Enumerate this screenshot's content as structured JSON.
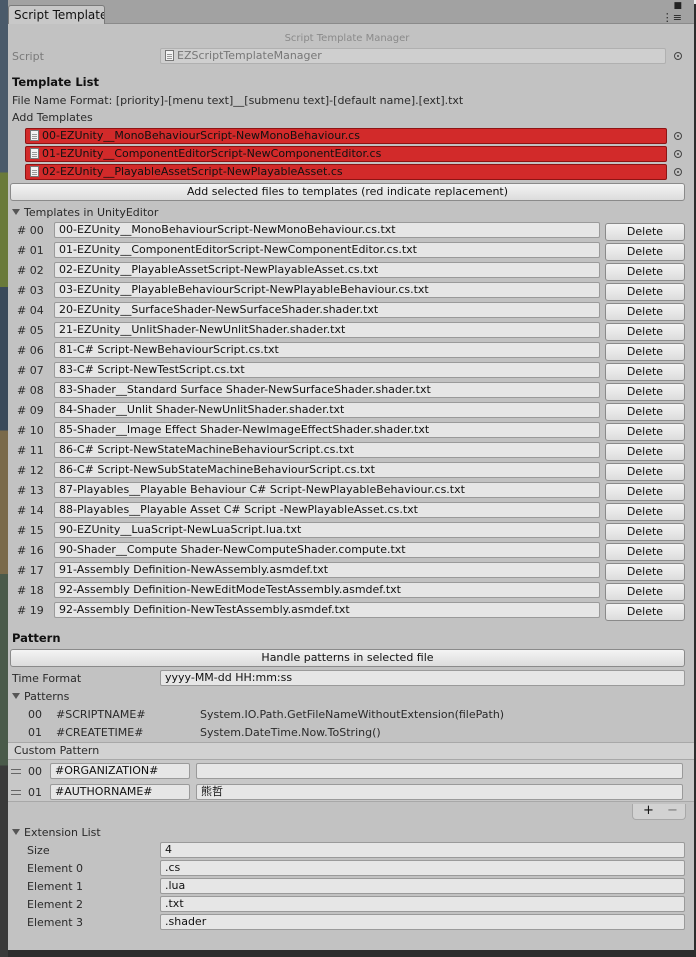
{
  "tab": {
    "title": "Script Template"
  },
  "header": {
    "title": "Script Template Manager"
  },
  "script_field": {
    "label": "Script",
    "value": "EZScriptTemplateManager"
  },
  "template_list": {
    "heading": "Template List",
    "file_name_format": "File Name Format: [priority]-[menu text]__[submenu text]-[default name].[ext].txt",
    "add_templates_label": "Add Templates",
    "add_files": [
      "00-EZUnity__MonoBehaviourScript-NewMonoBehaviour.cs",
      "01-EZUnity__ComponentEditorScript-NewComponentEditor.cs",
      "02-EZUnity__PlayableAssetScript-NewPlayableAsset.cs"
    ],
    "add_button": "Add selected files to templates (red indicate replacement)"
  },
  "templates_in_editor": {
    "foldout": "Templates in UnityEditor",
    "delete_label": "Delete",
    "items": [
      {
        "index": "# 00",
        "name": "00-EZUnity__MonoBehaviourScript-NewMonoBehaviour.cs.txt"
      },
      {
        "index": "# 01",
        "name": "01-EZUnity__ComponentEditorScript-NewComponentEditor.cs.txt"
      },
      {
        "index": "# 02",
        "name": "02-EZUnity__PlayableAssetScript-NewPlayableAsset.cs.txt"
      },
      {
        "index": "# 03",
        "name": "03-EZUnity__PlayableBehaviourScript-NewPlayableBehaviour.cs.txt"
      },
      {
        "index": "# 04",
        "name": "20-EZUnity__SurfaceShader-NewSurfaceShader.shader.txt"
      },
      {
        "index": "# 05",
        "name": "21-EZUnity__UnlitShader-NewUnlitShader.shader.txt"
      },
      {
        "index": "# 06",
        "name": "81-C# Script-NewBehaviourScript.cs.txt"
      },
      {
        "index": "# 07",
        "name": "83-C# Script-NewTestScript.cs.txt"
      },
      {
        "index": "# 08",
        "name": "83-Shader__Standard Surface Shader-NewSurfaceShader.shader.txt"
      },
      {
        "index": "# 09",
        "name": "84-Shader__Unlit Shader-NewUnlitShader.shader.txt"
      },
      {
        "index": "# 10",
        "name": "85-Shader__Image Effect Shader-NewImageEffectShader.shader.txt"
      },
      {
        "index": "# 11",
        "name": "86-C# Script-NewStateMachineBehaviourScript.cs.txt"
      },
      {
        "index": "# 12",
        "name": "86-C# Script-NewSubStateMachineBehaviourScript.cs.txt"
      },
      {
        "index": "# 13",
        "name": "87-Playables__Playable Behaviour C# Script-NewPlayableBehaviour.cs.txt"
      },
      {
        "index": "# 14",
        "name": "88-Playables__Playable Asset C# Script -NewPlayableAsset.cs.txt"
      },
      {
        "index": "# 15",
        "name": "90-EZUnity__LuaScript-NewLuaScript.lua.txt"
      },
      {
        "index": "# 16",
        "name": "90-Shader__Compute Shader-NewComputeShader.compute.txt"
      },
      {
        "index": "# 17",
        "name": "91-Assembly Definition-NewAssembly.asmdef.txt"
      },
      {
        "index": "# 18",
        "name": "92-Assembly Definition-NewEditModeTestAssembly.asmdef.txt"
      },
      {
        "index": "# 19",
        "name": "92-Assembly Definition-NewTestAssembly.asmdef.txt"
      }
    ]
  },
  "pattern": {
    "heading": "Pattern",
    "handle_button": "Handle patterns in selected file",
    "time_format_label": "Time Format",
    "time_format_value": "yyyy-MM-dd HH:mm:ss",
    "patterns_foldout": "Patterns",
    "patterns": [
      {
        "index": "00",
        "key": "#SCRIPTNAME#",
        "value": "System.IO.Path.GetFileNameWithoutExtension(filePath)"
      },
      {
        "index": "01",
        "key": "#CREATETIME#",
        "value": "System.DateTime.Now.ToString()"
      }
    ],
    "custom_pattern_label": "Custom Pattern",
    "custom": [
      {
        "index": "00",
        "key": "#ORGANIZATION#",
        "value": ""
      },
      {
        "index": "01",
        "key": "#AUTHORNAME#",
        "value": "熊哲"
      }
    ],
    "add_symbol": "+",
    "remove_symbol": "−"
  },
  "extension_list": {
    "foldout": "Extension List",
    "size_label": "Size",
    "size_value": "4",
    "elements": [
      {
        "label": "Element 0",
        "value": ".cs"
      },
      {
        "label": "Element 1",
        "value": ".lua"
      },
      {
        "label": "Element 2",
        "value": ".txt"
      },
      {
        "label": "Element 3",
        "value": ".shader"
      }
    ]
  },
  "colors": {
    "window_bg": "#c2c2c2",
    "replacement_red": "#d22a2a"
  }
}
